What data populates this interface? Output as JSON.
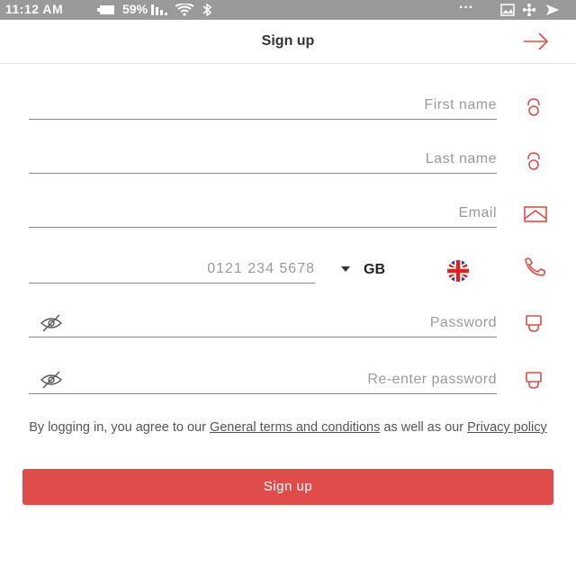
{
  "status_bar": {
    "time": "11:12 AM",
    "battery_percent": "59%",
    "more": "···",
    "icons": [
      "battery-icon",
      "signal-icon",
      "wifi-icon",
      "bluetooth-icon",
      "image-icon",
      "fan-icon",
      "send-icon"
    ]
  },
  "header": {
    "title": "Sign up",
    "back_icon": "arrow-icon"
  },
  "form": {
    "first_name": {
      "placeholder": "First name",
      "icon": "person-icon"
    },
    "last_name": {
      "placeholder": "Last name",
      "icon": "person-icon"
    },
    "email": {
      "placeholder": "Email",
      "icon": "envelope-icon"
    },
    "phone": {
      "placeholder": "0121 234 5678",
      "icon": "phone-icon",
      "country_code": "GB",
      "flag": "uk-flag-icon"
    },
    "password": {
      "placeholder": "Password",
      "icon": "lock-icon",
      "toggle_icon": "eye-off-icon"
    },
    "repassword": {
      "placeholder": "Re-enter password",
      "icon": "lock-icon",
      "toggle_icon": "eye-off-icon"
    }
  },
  "terms": {
    "prefix": "By logging in, you agree to our",
    "terms_link": "General terms and conditions",
    "middle": "as well as our",
    "privacy_link": "Privacy policy"
  },
  "submit": {
    "label": "Sign up"
  },
  "colors": {
    "accent": "#e04c49",
    "status_bar": "#9a9a9a",
    "underline": "#8a8a8a",
    "placeholder": "#9a9a9a"
  }
}
